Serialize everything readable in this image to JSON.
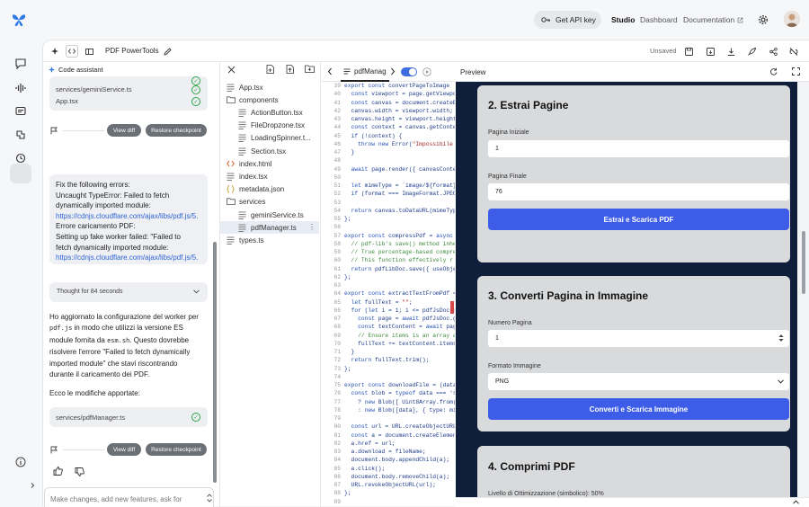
{
  "nav": {
    "api_key_label": "Get API key",
    "studio": "Studio",
    "dashboard": "Dashboard",
    "documentation": "Documentation"
  },
  "toolbar": {
    "project_title": "PDF PowerTools",
    "unsaved": "Unsaved"
  },
  "chat": {
    "header": "Code assistant",
    "top_files": [
      "services/geminiService.ts",
      "App.tsx"
    ],
    "view_diff": "View diff",
    "restore": "Restore checkpoint",
    "user_message": {
      "l1": "Fix the following errors:",
      "l2": "Uncaught TypeError: Failed to fetch",
      "l3": "dynamically imported module:",
      "l4": "https://cdnjs.cloudflare.com/ajax/libs/pdf.js/5.",
      "l5": "Errore caricamento PDF:",
      "l6": "Setting up fake worker failed: \"Failed to",
      "l7": "fetch dynamically imported module:",
      "l8": "https://cdnjs.cloudflare.com/ajax/libs/pdf.js/5."
    },
    "thought": "Thought for 84 seconds",
    "reply": {
      "p1a": "Ho aggiornato la configurazione del worker per",
      "p1b_code": "pdf.js",
      "p1c": "in modo che utilizzi la versione ES",
      "p1d": "module fornita da",
      "p1e_code": "esm.sh",
      "p1f": ". Questo dovrebbe",
      "p1g": "risolvere l'errore \"Failed to fetch dynamically",
      "p1h": "imported module\" che stavi riscontrando",
      "p1i": "durante il caricamento dei PDF.",
      "p2": "Ecco le modifiche apportate:"
    },
    "changed_file": "services/pdfManager.ts",
    "input_placeholder": "Make changes, add new features, ask for"
  },
  "tree": {
    "items": [
      {
        "name": "App.tsx",
        "type": "file"
      },
      {
        "name": "components",
        "type": "folder"
      },
      {
        "name": "ActionButton.tsx",
        "type": "file"
      },
      {
        "name": "FileDropzone.tsx",
        "type": "file"
      },
      {
        "name": "LoadingSpinner.t...",
        "type": "file"
      },
      {
        "name": "Section.tsx",
        "type": "file"
      },
      {
        "name": "index.html",
        "type": "html"
      },
      {
        "name": "index.tsx",
        "type": "file"
      },
      {
        "name": "metadata.json",
        "type": "json"
      },
      {
        "name": "services",
        "type": "folder"
      },
      {
        "name": "geminiService.ts",
        "type": "file"
      },
      {
        "name": "pdfManager.ts",
        "type": "file"
      },
      {
        "name": "types.ts",
        "type": "file"
      }
    ]
  },
  "editor": {
    "tab_name": "pdfManag",
    "line_numbers": [
      "39",
      "40",
      "41",
      "42",
      "43",
      "44",
      "45",
      "46",
      "47",
      "48",
      "49",
      "50",
      "51",
      "52",
      "53",
      "54",
      "55",
      "56",
      "57",
      "58",
      "59",
      "60",
      "61",
      "62",
      "63",
      "64",
      "65",
      "66",
      "67",
      "68",
      "69",
      "70",
      "71",
      "72",
      "73",
      "74",
      "75",
      "76",
      "77",
      "78",
      "79",
      "80",
      "81",
      "82",
      "83",
      "84",
      "85",
      "86",
      "87",
      "88",
      "89",
      "90",
      "91",
      "92",
      "93",
      "94",
      "95",
      "96",
      "97",
      "98"
    ],
    "lines": [
      "export const convertPageToImage",
      "  const viewport = page.getViewpo",
      "  const canvas = document.createE",
      "  canvas.width = viewport.width;",
      "  canvas.height = viewport.height",
      "  const context = canvas.getConte",
      "  if (!context) {",
      "    throw new Error(\"Impossibile",
      "  }",
      "",
      "  await page.render({ canvasConte",
      "",
      "  let mimeType = `image/${format}",
      "  if (format === ImageFormat.JPEG",
      "",
      "  return canvas.toDataURL(mimeTyp",
      "};",
      "",
      "export const compressPdf = async",
      "  // pdf-lib's save() method inhe",
      "  // True percentage-based compre",
      "  // This function effectively r",
      "  return pdfLibDoc.save({ useObje",
      "};",
      "",
      "export const extractTextFromPdf =",
      "  let fullText = \"\";",
      "  for (let i = 1; i <= pdfJsDoc.n",
      "    const page = await pdfJsDoc.g",
      "    const textContent = await pag",
      "    // Ensure items is an array a",
      "    fullText += textContent.items",
      "  }",
      "  return fullText.trim();",
      "};",
      "",
      "export const downloadFile = (data",
      "  const blob = typeof data === 's",
      "    ? new Blob([ Uint8Array.from(",
      "    : new Blob([data], { type: mi",
      "",
      "  const url = URL.createObjectURL",
      "  const a = document.createElemen",
      "  a.href = url;",
      "  a.download = fileName;",
      "  document.body.appendChild(a);",
      "  a.click();",
      "  document.body.removeChild(a);",
      "  URL.revokeObjectURL(url);",
      "};",
      ""
    ]
  },
  "preview": {
    "label": "Preview",
    "extract": {
      "title": "2. Estrai Pagine",
      "start_label": "Pagina Iniziale",
      "start_value": "1",
      "end_label": "Pagina Finale",
      "end_value": "76",
      "button": "Estrai e Scarica PDF"
    },
    "convert": {
      "title": "3. Converti Pagina in Immagine",
      "page_label": "Numero Pagina",
      "page_value": "1",
      "format_label": "Formato Immagine",
      "format_value": "PNG",
      "button": "Converti e Scarica Immagine"
    },
    "compress": {
      "title": "4. Comprimi PDF",
      "level_label": "Livello di Ottimizzazione (simbolico): 50%",
      "level_fraction": 0.5
    }
  }
}
